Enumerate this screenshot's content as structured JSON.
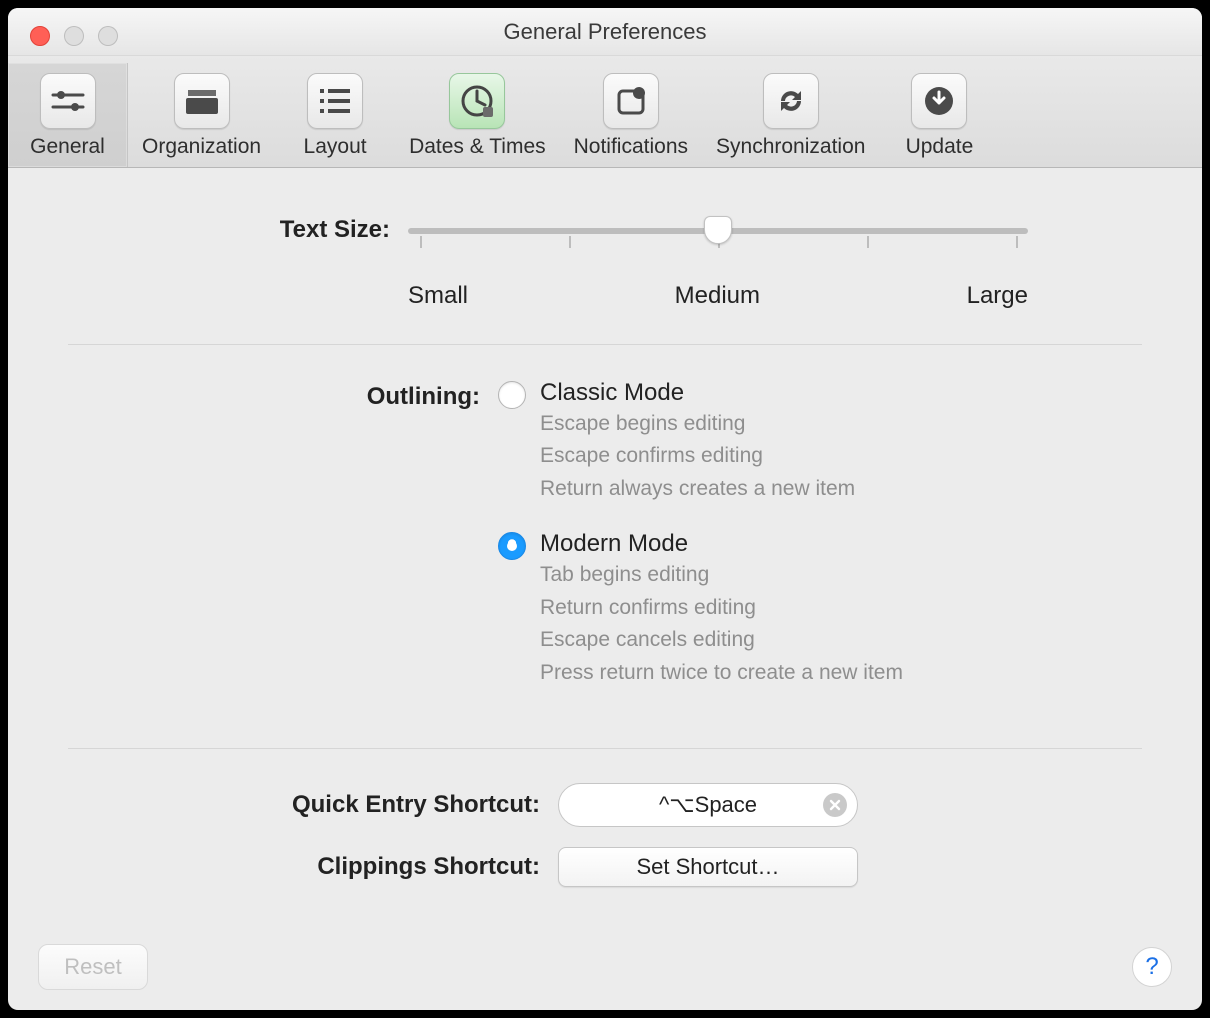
{
  "window": {
    "title": "General Preferences"
  },
  "toolbar": {
    "tabs": [
      {
        "label": "General"
      },
      {
        "label": "Organization"
      },
      {
        "label": "Layout"
      },
      {
        "label": "Dates & Times"
      },
      {
        "label": "Notifications"
      },
      {
        "label": "Synchronization"
      },
      {
        "label": "Update"
      }
    ],
    "selected_index": 0
  },
  "text_size": {
    "label": "Text Size:",
    "marks": {
      "small": "Small",
      "medium": "Medium",
      "large": "Large"
    },
    "value_index": 2,
    "num_marks": 5
  },
  "outlining": {
    "label": "Outlining:",
    "selected": "modern",
    "classic": {
      "title": "Classic Mode",
      "desc1": "Escape begins editing",
      "desc2": "Escape confirms editing",
      "desc3": "Return always creates a new item"
    },
    "modern": {
      "title": "Modern Mode",
      "desc1": "Tab begins editing",
      "desc2": "Return confirms editing",
      "desc3": "Escape cancels editing",
      "desc4": "Press return twice to create a new item"
    }
  },
  "quick_entry": {
    "label": "Quick Entry Shortcut:",
    "value": "^⌥Space"
  },
  "clippings": {
    "label": "Clippings Shortcut:",
    "button": "Set Shortcut…"
  },
  "footer": {
    "reset": "Reset",
    "help": "?"
  }
}
